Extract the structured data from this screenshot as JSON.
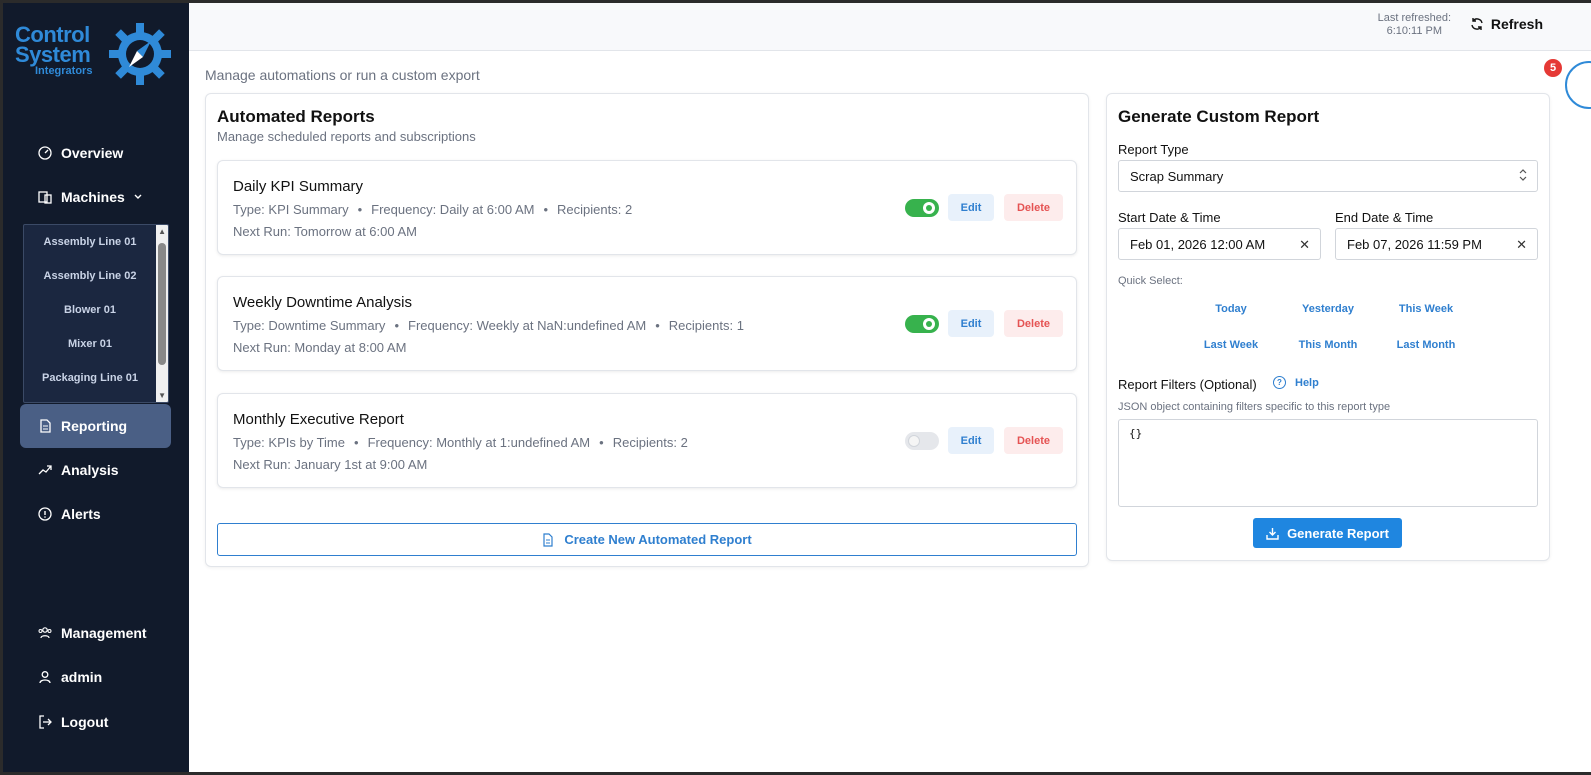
{
  "brand": {
    "line1": "Control",
    "line2": "System",
    "line3": "Integrators",
    "color": "#2f8ad8"
  },
  "sidebar": {
    "items": [
      {
        "label": "Overview",
        "icon": "gauge-icon"
      },
      {
        "label": "Machines",
        "icon": "machines-icon"
      },
      {
        "label": "Reporting",
        "icon": "document-icon",
        "active": true
      },
      {
        "label": "Analysis",
        "icon": "trend-icon"
      },
      {
        "label": "Alerts",
        "icon": "alert-circle-icon"
      }
    ],
    "machines": [
      "Assembly Line 01",
      "Assembly Line 02",
      "Blower 01",
      "Mixer 01",
      "Packaging Line 01"
    ],
    "bottom": [
      {
        "label": "Management",
        "icon": "users-icon"
      },
      {
        "label": "admin",
        "icon": "user-icon"
      },
      {
        "label": "Logout",
        "icon": "logout-icon"
      }
    ]
  },
  "header": {
    "last_refreshed_label": "Last refreshed:",
    "last_refreshed_time": "6:10:11 PM",
    "refresh_label": "Refresh",
    "notification_count": "5"
  },
  "page": {
    "subtitle": "Manage automations or run a custom export"
  },
  "automated": {
    "title": "Automated Reports",
    "subtitle": "Manage scheduled reports and subscriptions",
    "reports": [
      {
        "name": "Daily KPI Summary",
        "type": "Type: KPI Summary",
        "frequency": "Frequency: Daily at 6:00 AM",
        "recipients": "Recipients: 2",
        "next": "Next Run: Tomorrow at 6:00 AM",
        "enabled": true
      },
      {
        "name": "Weekly Downtime Analysis",
        "type": "Type: Downtime Summary",
        "frequency": "Frequency: Weekly at NaN:undefined AM",
        "recipients": "Recipients: 1",
        "next": "Next Run: Monday at 8:00 AM",
        "enabled": true
      },
      {
        "name": "Monthly Executive Report",
        "type": "Type: KPIs by Time",
        "frequency": "Frequency: Monthly at 1:undefined AM",
        "recipients": "Recipients: 2",
        "next": "Next Run: January 1st at 9:00 AM",
        "enabled": false
      }
    ],
    "edit_label": "Edit",
    "delete_label": "Delete",
    "create_label": "Create New Automated Report"
  },
  "custom": {
    "title": "Generate Custom Report",
    "report_type_label": "Report Type",
    "report_type_value": "Scrap Summary",
    "start_label": "Start Date & Time",
    "start_value": "Feb 01, 2026 12:00 AM",
    "end_label": "End Date & Time",
    "end_value": "Feb 07, 2026 11:59 PM",
    "quick_select_label": "Quick Select:",
    "quick": [
      "Today",
      "Yesterday",
      "This Week",
      "Last Week",
      "This Month",
      "Last Month"
    ],
    "filters_label": "Report Filters (Optional)",
    "help_label": "Help",
    "filters_hint": "JSON object containing filters specific to this report type",
    "filters_value": "{}",
    "generate_label": "Generate Report"
  }
}
